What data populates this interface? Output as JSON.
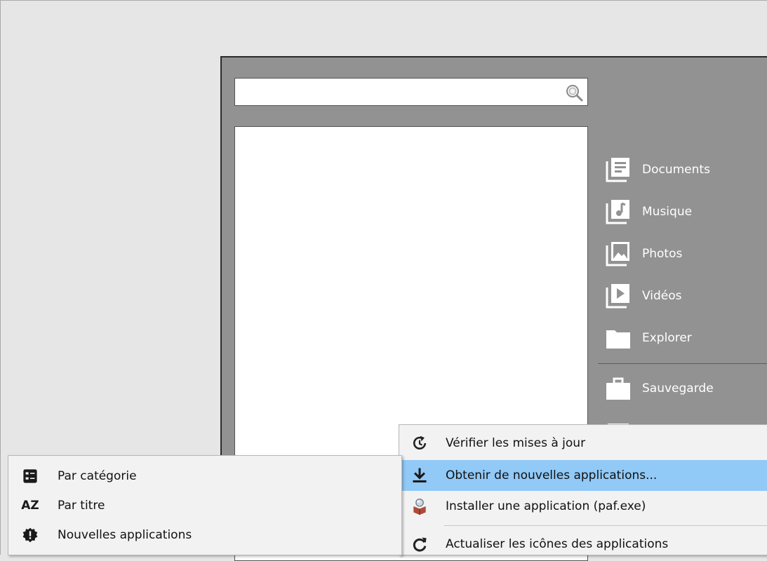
{
  "search": {
    "value": "",
    "placeholder": ""
  },
  "folders": [
    {
      "label": "Documents",
      "icon": "documents-icon"
    },
    {
      "label": "Musique",
      "icon": "music-icon"
    },
    {
      "label": "Photos",
      "icon": "photos-icon"
    },
    {
      "label": "Vidéos",
      "icon": "videos-icon"
    },
    {
      "label": "Explorer",
      "icon": "folder-icon"
    },
    {
      "label": "Sauvegarde",
      "icon": "briefcase-icon"
    }
  ],
  "context_menu": {
    "items": [
      {
        "label": "Vérifier les mises à jour",
        "icon": "update-check-icon"
      },
      {
        "label": "Obtenir de nouvelles applications...",
        "icon": "download-icon",
        "highlighted": true
      },
      {
        "label": "Installer une application (paf.exe)",
        "icon": "install-package-icon"
      },
      {
        "label": "Actualiser les icônes des applications",
        "icon": "refresh-icon"
      }
    ]
  },
  "sort_menu": {
    "items": [
      {
        "label": "Par catégorie",
        "icon": "category-icon"
      },
      {
        "label": "Par titre",
        "icon": "sort-az-icon",
        "icon_text": "AZ"
      },
      {
        "label": "Nouvelles applications",
        "icon": "new-badge-icon"
      }
    ]
  },
  "colors": {
    "highlight": "#91c9f7",
    "panel": "#929292",
    "background": "#e6e6e6"
  }
}
